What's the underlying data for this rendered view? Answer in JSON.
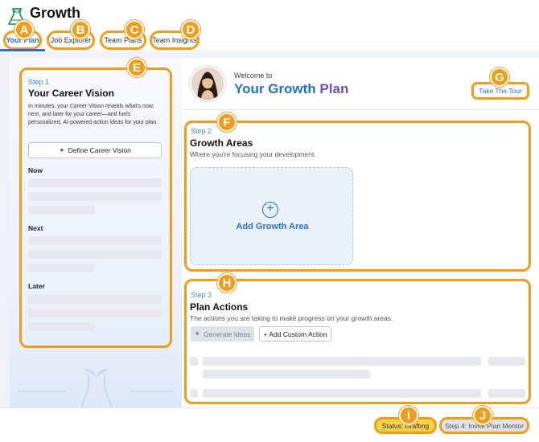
{
  "header": {
    "app_title": "Growth",
    "tabs": [
      {
        "label": "Your Plan",
        "active": true
      },
      {
        "label": "Job Explorer"
      },
      {
        "label": "Team Plans"
      },
      {
        "label": "Team Insights"
      }
    ]
  },
  "badges": [
    "A",
    "B",
    "C",
    "D",
    "E",
    "F",
    "G",
    "H",
    "I",
    "J"
  ],
  "career_vision": {
    "step": "Step 1",
    "title": "Your Career Vision",
    "description": "In minutes, your Career Vision reveals what's now, next, and later for your career—and fuels personalized, AI-powered action ideas for your plan.",
    "button_label": "Define Career Vision",
    "sections": [
      "Now",
      "Next",
      "Later"
    ]
  },
  "welcome": {
    "greeting": "Welcome to",
    "title_part1": "Your Growth",
    "title_part2": "Plan",
    "tour_button": "Take The Tour"
  },
  "growth_areas": {
    "step": "Step 2",
    "title": "Growth Areas",
    "subtitle": "Where you're focusing your development.",
    "add_label": "Add Growth Area"
  },
  "plan_actions": {
    "step": "Step 3",
    "title": "Plan Actions",
    "subtitle": "The actions you are taking to make progress on your growth areas.",
    "generate_label": "Generate Ideas",
    "add_custom_label": "+ Add Custom Action"
  },
  "footer": {
    "status": "Status: Drafting",
    "next_step": "Step 4: Invite Plan Mentor"
  },
  "colors": {
    "accent": "#2f6bd9",
    "highlight": "#f39c1a",
    "status_bg": "#f6d24a"
  }
}
